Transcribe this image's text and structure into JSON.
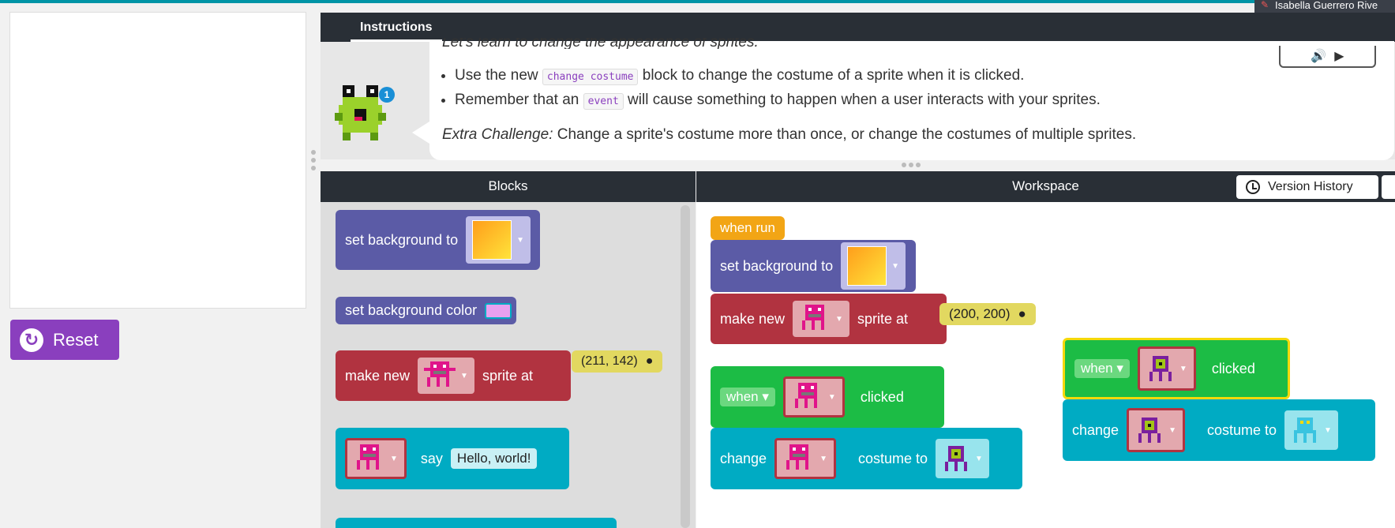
{
  "user": {
    "name": "Isabella Guerrero Rive"
  },
  "reset_label": "Reset",
  "instructions": {
    "tab_label": "Instructions",
    "cut_line": "Let's learn to change the appearance of sprites.",
    "bullet1_pre": "Use the new ",
    "bullet1_code": "change costume",
    "bullet1_post": " block to change the costume of a sprite when it is clicked.",
    "bullet2_pre": "Remember that an ",
    "bullet2_code": "event",
    "bullet2_post": " will cause something to happen when a user interacts with your sprites.",
    "extra_label": "Extra Challenge:",
    "extra_text": " Change a sprite's costume more than once, or change the costumes of multiple sprites.",
    "badge_count": "1"
  },
  "headers": {
    "blocks": "Blocks",
    "workspace": "Workspace",
    "version_history": "Version History"
  },
  "toolbox": {
    "set_background": "set background to",
    "set_background_color": "set background color",
    "make_new": "make new",
    "sprite_at": "sprite at",
    "make_coords": "(211, 142)",
    "say": "say",
    "say_text": "Hello, world!"
  },
  "workspace": {
    "when_run": "when run",
    "set_background": "set background to",
    "make_new": "make new",
    "sprite_at": "sprite at",
    "make_coords": "(200, 200)",
    "when": "when",
    "clicked": "clicked",
    "change": "change",
    "costume_to": "costume to"
  }
}
